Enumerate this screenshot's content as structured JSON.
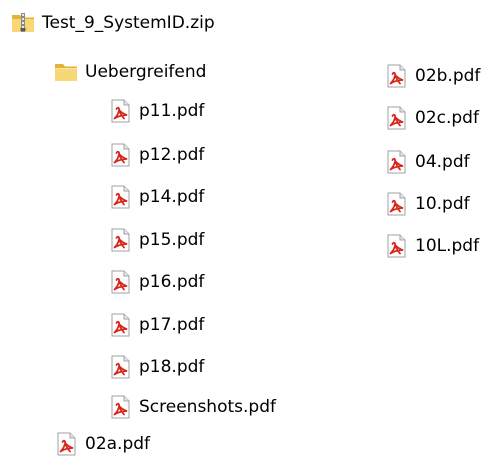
{
  "tree": {
    "root": {
      "label": "Test_9_SystemID.zip",
      "icon": "zip-folder-icon"
    },
    "folder": {
      "label": "Uebergreifend",
      "icon": "folder-icon"
    },
    "folder_files": [
      {
        "label": "p11.pdf",
        "icon": "pdf-icon"
      },
      {
        "label": "p12.pdf",
        "icon": "pdf-icon"
      },
      {
        "label": "p14.pdf",
        "icon": "pdf-icon"
      },
      {
        "label": "p15.pdf",
        "icon": "pdf-icon"
      },
      {
        "label": "p16.pdf",
        "icon": "pdf-icon"
      },
      {
        "label": "p17.pdf",
        "icon": "pdf-icon"
      },
      {
        "label": "p18.pdf",
        "icon": "pdf-icon"
      },
      {
        "label": "Screenshots.pdf",
        "icon": "pdf-icon"
      }
    ],
    "root_files": [
      {
        "label": "02a.pdf",
        "icon": "pdf-icon"
      }
    ],
    "right_files": [
      {
        "label": "02b.pdf",
        "icon": "pdf-icon"
      },
      {
        "label": "02c.pdf",
        "icon": "pdf-icon"
      },
      {
        "label": "04.pdf",
        "icon": "pdf-icon"
      },
      {
        "label": "10.pdf",
        "icon": "pdf-icon"
      },
      {
        "label": "10L.pdf",
        "icon": "pdf-icon"
      }
    ]
  },
  "colors": {
    "folder_body": "#f8d775",
    "folder_tab": "#e2b23a",
    "zipper": "#7a7a7a",
    "pdf_red": "#d8261c"
  }
}
